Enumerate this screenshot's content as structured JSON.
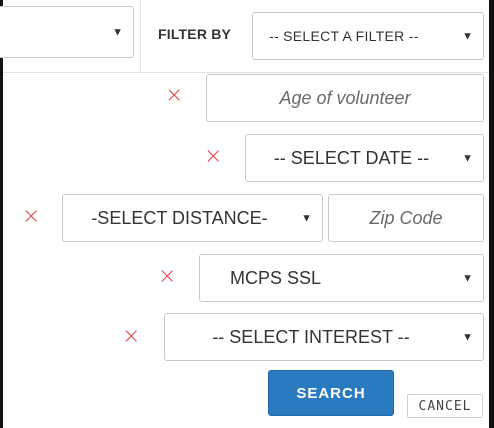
{
  "top_bar": {
    "filter_label": "FILTER BY",
    "filter_select_value": "-- SELECT A FILTER --",
    "caret": "▼"
  },
  "filters": {
    "age_placeholder": "Age of volunteer",
    "date_value": "-- SELECT DATE --",
    "distance_value": "-SELECT DISTANCE-",
    "zip_placeholder": "Zip Code",
    "ssl_value": "MCPS SSL",
    "interest_value": "-- SELECT INTEREST --",
    "remove_symbol": "×"
  },
  "actions": {
    "search_label": "SEARCH",
    "cancel_label": "CANCEL"
  },
  "colors": {
    "accent": "#2a7ac0",
    "remove": "#e0454b"
  },
  "icons": {
    "remove": "close-icon",
    "dropdown": "chevron-down-icon"
  }
}
